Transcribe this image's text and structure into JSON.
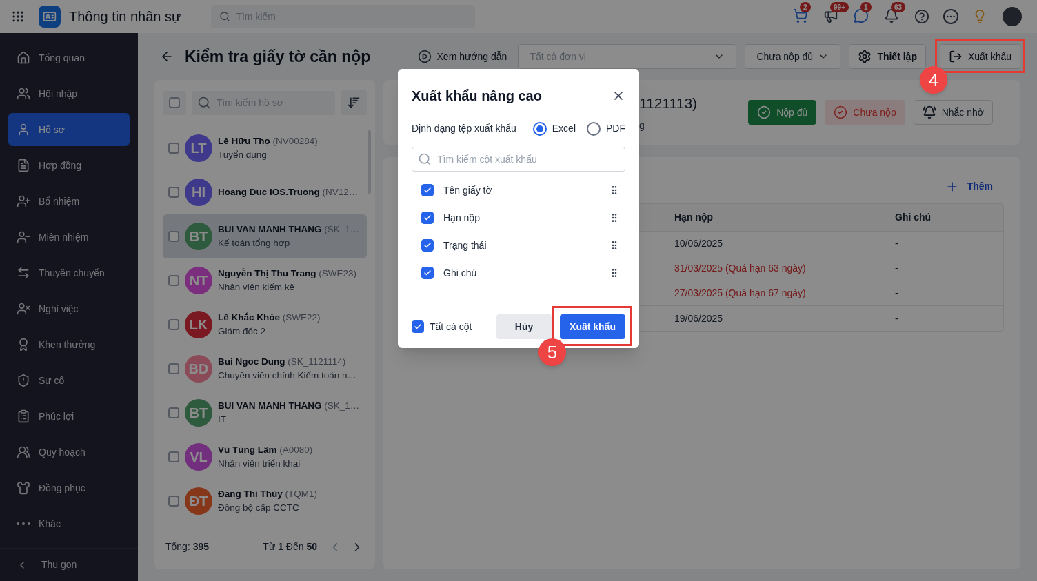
{
  "app_bar": {
    "app_name": "Thông tin nhân sự",
    "search": {
      "placeholder": "Tìm kiếm"
    },
    "badges": [
      {
        "kind": "cart",
        "count": "2"
      },
      {
        "kind": "megaphone",
        "count": "99+"
      },
      {
        "kind": "chat",
        "count": "1"
      },
      {
        "kind": "bell",
        "count": "63"
      }
    ]
  },
  "sidebar": {
    "items": [
      {
        "label": "Tổng quan",
        "selected": false
      },
      {
        "label": "Hội nhập",
        "selected": false
      },
      {
        "label": "Hồ sơ",
        "selected": true
      },
      {
        "label": "Hợp đồng",
        "selected": false
      },
      {
        "label": "Bổ nhiệm",
        "selected": false
      },
      {
        "label": "Miễn nhiệm",
        "selected": false
      },
      {
        "label": "Thuyên chuyển",
        "selected": false
      },
      {
        "label": "Nghỉ việc",
        "selected": false
      },
      {
        "label": "Khen thưởng",
        "selected": false
      },
      {
        "label": "Sự cố",
        "selected": false
      },
      {
        "label": "Phúc lợi",
        "selected": false
      },
      {
        "label": "Quy hoạch",
        "selected": false
      },
      {
        "label": "Đồng phục",
        "selected": false
      },
      {
        "label": "Khác",
        "selected": false
      }
    ],
    "collapse": "Thu gọn"
  },
  "page": {
    "title": "Kiểm tra giấy tờ cần nộp",
    "guide": "Xem hướng dẫn",
    "unit_select": {
      "placeholder": "Tất cả đơn vị"
    },
    "status_select": {
      "value": "Chưa nộp đủ"
    },
    "settings": "Thiết lập",
    "export": "Xuất khẩu"
  },
  "employee_list": {
    "select_all": {
      "checked": false
    },
    "search": {
      "placeholder": "Tìm kiếm hồ sơ"
    },
    "items": [
      {
        "initials": "LT",
        "name": "Lê Hữu Thọ",
        "code": "(NV00284)",
        "position": "Tuyển dụng",
        "color": "#3f3a8c",
        "checked": false,
        "selected": false
      },
      {
        "initials": "HI",
        "name": "Hoang Duc IOS.Truong",
        "code": "(NV12…",
        "color": "#3f3a8c",
        "checked": false,
        "selected": false
      },
      {
        "initials": "BT",
        "name": "BUI VAN MANH THANG",
        "code": "(SK_1…",
        "position": "Kế toán tổng hợp",
        "color": "#2f5a3d",
        "checked": false,
        "selected": true
      },
      {
        "initials": "NT",
        "name": "Nguyễn Thị Thu Trang",
        "code": "(SWE23)",
        "position": "Nhân viên kiểm kê",
        "color": "#7a2f7d",
        "checked": false,
        "selected": false
      },
      {
        "initials": "LK",
        "name": "Lê Khắc Khỏe",
        "code": "(SWE22)",
        "position": "Giám đốc 2",
        "color": "#7a1a22",
        "checked": false,
        "selected": false
      },
      {
        "initials": "BD",
        "name": "Bui Ngoc Dung",
        "code": "(SK_1121114)",
        "position": "Chuyên viên chính Kiểm toán n…",
        "color": "#8a4a58",
        "checked": false,
        "selected": false
      },
      {
        "initials": "BT",
        "name": "BUI VAN MANH THANG",
        "code": "(SK_1…",
        "position": "IT",
        "color": "#2f5a3d",
        "checked": false,
        "selected": false
      },
      {
        "initials": "VL",
        "name": "Vũ Tùng Lâm",
        "code": "(A0080)",
        "position": "Nhân viên triển khai",
        "color": "#72307e",
        "checked": false,
        "selected": false
      },
      {
        "initials": "ĐT",
        "name": "Đăng Thị Thúy",
        "code": "(TQM1)",
        "position": "Đồng bộ cấp CCTC",
        "color": "#86371b",
        "checked": false,
        "selected": false
      }
    ],
    "total_label": "Tổng:",
    "total": "395",
    "from_label": "Từ",
    "from": "1",
    "to_label": "Đến",
    "to": "50"
  },
  "detail": {
    "code_fragment": "1121113)",
    "subtitle_fragment": "g",
    "actions": [
      {
        "kind": "success",
        "label": "Nộp đủ"
      },
      {
        "kind": "danger",
        "label": "Chưa nộp"
      },
      {
        "kind": "neutral",
        "label": "Nhắc nhở"
      }
    ],
    "add": "Thêm",
    "table": {
      "columns": [
        "Hạn nộp",
        "Ghi chú"
      ],
      "rows": [
        {
          "deadline": "10/06/2025",
          "overdue": false,
          "note": "-"
        },
        {
          "deadline": "31/03/2025 (Quá hạn 63 ngày)",
          "overdue": true,
          "note": "-"
        },
        {
          "deadline": "27/03/2025 (Quá hạn 67 ngày)",
          "overdue": true,
          "note": "-"
        },
        {
          "deadline": "19/06/2025",
          "overdue": false,
          "note": "-"
        }
      ]
    }
  },
  "dialog": {
    "title": "Xuất khẩu nâng cao",
    "format_label": "Định dạng tệp xuất khẩu",
    "formats": [
      {
        "label": "Excel",
        "selected": true
      },
      {
        "label": "PDF",
        "selected": false
      }
    ],
    "search": {
      "placeholder": "Tìm kiếm cột xuất khẩu"
    },
    "columns": [
      {
        "label": "Tên giấy tờ",
        "checked": true
      },
      {
        "label": "Hạn nộp",
        "checked": true
      },
      {
        "label": "Trạng thái",
        "checked": true
      },
      {
        "label": "Ghi chú",
        "checked": true
      }
    ],
    "all_columns": {
      "label": "Tất cả cột",
      "checked": true
    },
    "cancel": "Hủy",
    "confirm": "Xuất khẩu"
  },
  "annotations": [
    {
      "label": "4"
    },
    {
      "label": "5"
    }
  ]
}
